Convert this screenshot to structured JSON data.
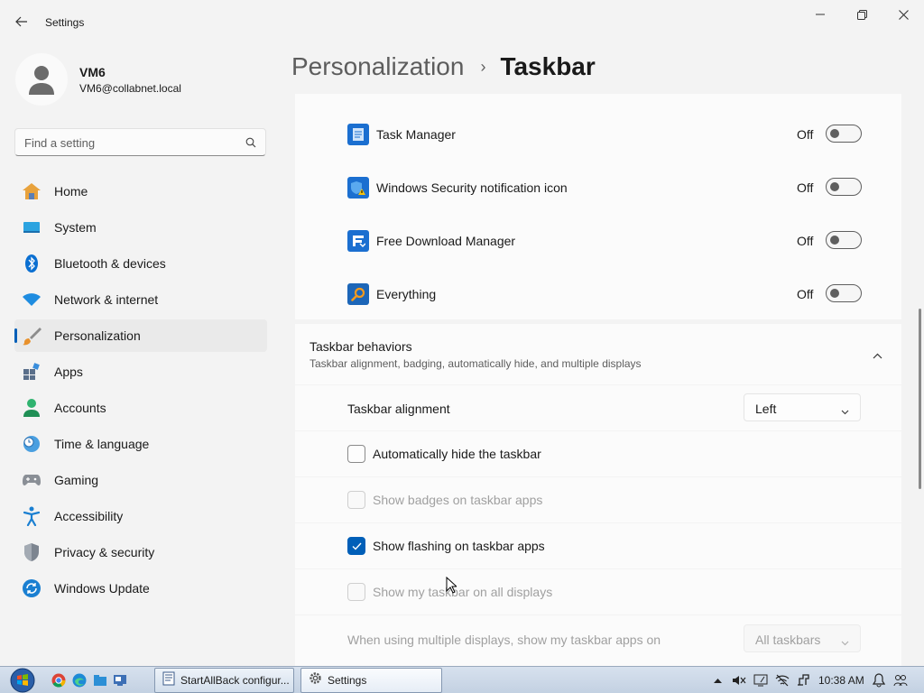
{
  "window": {
    "title": "Settings"
  },
  "profile": {
    "name": "VM6",
    "email": "VM6@collabnet.local"
  },
  "search": {
    "placeholder": "Find a setting"
  },
  "nav": {
    "items": [
      {
        "label": "Home",
        "icon": "home-icon"
      },
      {
        "label": "System",
        "icon": "system-icon"
      },
      {
        "label": "Bluetooth & devices",
        "icon": "bluetooth-icon"
      },
      {
        "label": "Network & internet",
        "icon": "wifi-icon"
      },
      {
        "label": "Personalization",
        "icon": "paintbrush-icon",
        "active": true
      },
      {
        "label": "Apps",
        "icon": "apps-icon"
      },
      {
        "label": "Accounts",
        "icon": "person-icon"
      },
      {
        "label": "Time & language",
        "icon": "clock-globe-icon"
      },
      {
        "label": "Gaming",
        "icon": "gamepad-icon"
      },
      {
        "label": "Accessibility",
        "icon": "accessibility-icon"
      },
      {
        "label": "Privacy & security",
        "icon": "shield-icon"
      },
      {
        "label": "Windows Update",
        "icon": "update-icon"
      }
    ]
  },
  "header": {
    "parent": "Personalization",
    "separator": "›",
    "current": "Taskbar"
  },
  "tray_apps": [
    {
      "label": "Task Manager",
      "state": "Off",
      "icon": "task-manager-icon"
    },
    {
      "label": "Windows Security notification icon",
      "state": "Off",
      "icon": "windows-security-icon"
    },
    {
      "label": "Free Download Manager",
      "state": "Off",
      "icon": "free-download-manager-icon"
    },
    {
      "label": "Everything",
      "state": "Off",
      "icon": "everything-search-icon"
    }
  ],
  "behaviors": {
    "title": "Taskbar behaviors",
    "subtitle": "Taskbar alignment, badging, automatically hide, and multiple displays",
    "alignment": {
      "label": "Taskbar alignment",
      "value": "Left"
    },
    "autohide": {
      "label": "Automatically hide the taskbar",
      "checked": false,
      "enabled": true
    },
    "badges": {
      "label": "Show badges on taskbar apps",
      "checked": false,
      "enabled": false
    },
    "flashing": {
      "label": "Show flashing on taskbar apps",
      "checked": true,
      "enabled": true
    },
    "all_displays": {
      "label": "Show my taskbar on all displays",
      "checked": false,
      "enabled": false
    },
    "multi_display": {
      "label": "When using multiple displays, show my taskbar apps on",
      "value": "All taskbars",
      "enabled": false
    }
  },
  "colors": {
    "accent": "#005fb8",
    "taskbar": "#cfdae8"
  },
  "taskbar": {
    "buttons": [
      {
        "label": "StartAllBack configur...",
        "icon": "startallback-icon"
      },
      {
        "label": "Settings",
        "icon": "gear-icon",
        "active": true
      }
    ],
    "clock": "10:38 AM"
  }
}
